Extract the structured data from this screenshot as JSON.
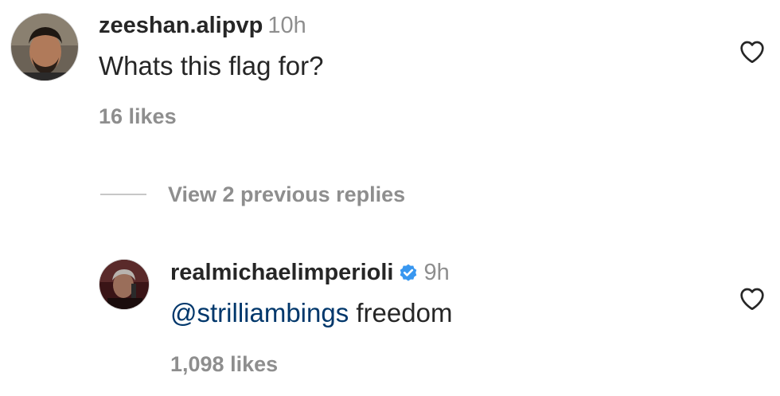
{
  "comments": [
    {
      "username": "zeeshan.alipvp",
      "time": "10h",
      "text": "Whats this flag for?",
      "likes": "16 likes",
      "verified": false,
      "liked": false
    },
    {
      "username": "realmichaelimperioli",
      "time": "9h",
      "mention": "@strilliambings",
      "text": " freedom",
      "likes": "1,098 likes",
      "verified": true,
      "liked": false
    }
  ],
  "thread": {
    "view_replies_label": "View 2 previous replies"
  },
  "colors": {
    "text": "#262626",
    "secondary": "#8e8e8e",
    "mention": "#00376b",
    "verified_badge": "#3897f0"
  },
  "icons": {
    "like": "heart-outline-icon",
    "verified": "verified-badge-icon"
  }
}
